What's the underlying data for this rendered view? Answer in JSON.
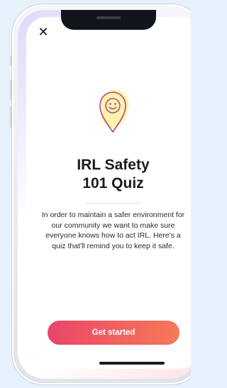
{
  "header": {
    "close_icon": "close-icon"
  },
  "hero": {
    "icon": "location-pin-smiley-icon",
    "title_line_1": "IRL Safety",
    "title_line_2": "101 Quiz"
  },
  "body": {
    "description": "In order to maintain a safer environment for our community we want to make sure everyone knows how to act IRL. Here's a quiz that'll remind you to keep it safe."
  },
  "actions": {
    "get_started_label": "Get started"
  },
  "colors": {
    "accent_start": "#e9456b",
    "accent_end": "#f47a59",
    "pin_stroke": "#b13fa3",
    "pin_fill": "#fff4a8"
  }
}
